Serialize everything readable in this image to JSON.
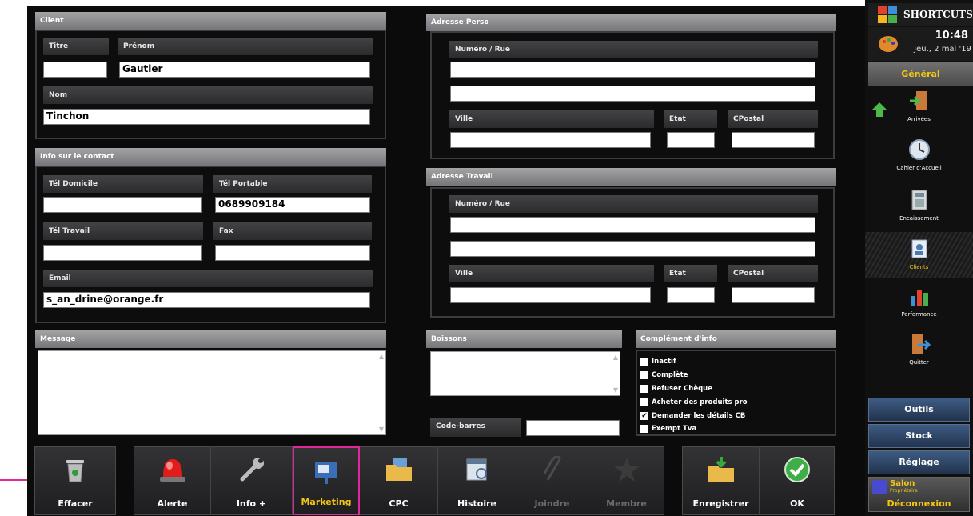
{
  "client": {
    "header": "Client",
    "titre_label": "Titre",
    "titre_value": "",
    "prenom_label": "Prénom",
    "prenom_value": "Gautier",
    "nom_label": "Nom",
    "nom_value": "Tinchon"
  },
  "contact": {
    "header": "Info sur le contact",
    "tel_domicile_label": "Tél Domicile",
    "tel_domicile_value": "",
    "tel_portable_label": "Tél Portable",
    "tel_portable_value": "0689909184",
    "tel_travail_label": "Tél Travail",
    "tel_travail_value": "",
    "fax_label": "Fax",
    "fax_value": "",
    "email_label": "Email",
    "email_value": "s_an_drine@orange.fr"
  },
  "adresse_perso": {
    "header": "Adresse Perso",
    "rue_label": "Numéro / Rue",
    "ville_label": "Ville",
    "etat_label": "Etat",
    "cpostal_label": "CPostal"
  },
  "adresse_travail": {
    "header": "Adresse Travail",
    "rue_label": "Numéro / Rue",
    "ville_label": "Ville",
    "etat_label": "Etat",
    "cpostal_label": "CPostal"
  },
  "message": {
    "header": "Message",
    "value": ""
  },
  "boissons": {
    "header": "Boissons",
    "value": ""
  },
  "codebarres": {
    "label": "Code-barres",
    "value": ""
  },
  "complement": {
    "header": "Complément d'info",
    "items": [
      {
        "label": "Inactif",
        "checked": false
      },
      {
        "label": "Complète",
        "checked": false
      },
      {
        "label": "Refuser Chèque",
        "checked": false
      },
      {
        "label": "Acheter des produits pro",
        "checked": false
      },
      {
        "label": "Demander les détails CB",
        "checked": true
      },
      {
        "label": "Exempt Tva",
        "checked": false
      }
    ]
  },
  "toolbar": {
    "effacer": "Effacer",
    "alerte": "Alerte",
    "info": "Info +",
    "marketing": "Marketing",
    "cpc": "CPC",
    "histoire": "Histoire",
    "joindre": "Joindre",
    "membre": "Membre",
    "enregistrer": "Enregistrer",
    "ok": "OK"
  },
  "sidebar": {
    "title": "SHORTCUTS",
    "time": "10:48",
    "date": "Jeu., 2 mai '19",
    "section": "Général",
    "nav": [
      "Arrivées",
      "Cahier d'Accueil",
      "Encaissement",
      "Clients",
      "Performance",
      "Quitter"
    ],
    "outils": "Outils",
    "stock": "Stock",
    "reglage": "Réglage",
    "user": "Salon",
    "role": "Propriétaire",
    "logout": "Déconnexion"
  },
  "colors": {
    "highlight": "#e3279b",
    "selected_text": "#f3c614",
    "section_text": "#f3c614"
  }
}
